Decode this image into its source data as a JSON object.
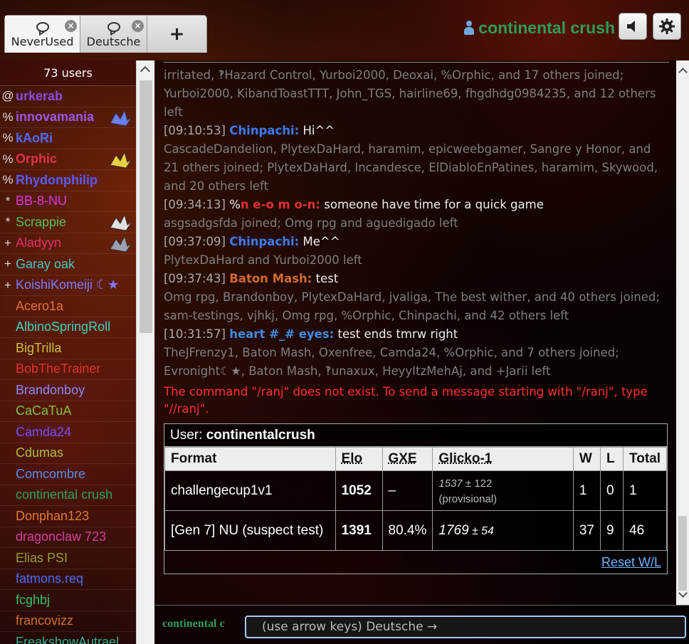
{
  "tabs": [
    {
      "label": "NeverUsed"
    },
    {
      "label": "Deutsche"
    }
  ],
  "tab_add_label": "+",
  "header": {
    "username": "continental crush"
  },
  "userlist": {
    "count_label": "73 users",
    "users": [
      {
        "rank": "@",
        "name": "urkerab",
        "color": "#8b4cd9",
        "bold": true
      },
      {
        "rank": "%",
        "name": "innovamania",
        "color": "#9a59e0",
        "bold": true,
        "sprite": "blue"
      },
      {
        "rank": "%",
        "name": "kAoRi",
        "color": "#4e6cf2",
        "bold": true
      },
      {
        "rank": "%",
        "name": "Orphic",
        "color": "#e0304a",
        "bold": true,
        "sprite": "yellow"
      },
      {
        "rank": "%",
        "name": "Rhydonphilip",
        "color": "#5a5cf5",
        "bold": true
      },
      {
        "rank": "*",
        "name": "BB-8-NU",
        "color": "#d83ad4",
        "bold": false
      },
      {
        "rank": "*",
        "name": "Scrappie",
        "color": "#4fc15f",
        "bold": false,
        "sprite": "white"
      },
      {
        "rank": "+",
        "name": "Aladyyn",
        "color": "#e0306a",
        "bold": false,
        "sprite": "grey"
      },
      {
        "rank": "+",
        "name": "Garay oak",
        "color": "#47c4c4",
        "bold": false
      },
      {
        "rank": "+",
        "name": "KoishiKomeiji ☾★",
        "color": "#7c7cf7",
        "bold": false
      },
      {
        "rank": "",
        "name": "Acero1a",
        "color": "#e0703a",
        "bold": false
      },
      {
        "rank": "",
        "name": "AlbinoSpringRoll",
        "color": "#40d0c0",
        "bold": false
      },
      {
        "rank": "",
        "name": "BigTrilla",
        "color": "#c9c040",
        "bold": false
      },
      {
        "rank": "",
        "name": "BobTheTrainer",
        "color": "#e03030",
        "bold": false
      },
      {
        "rank": "",
        "name": "Brandonboy",
        "color": "#8a8af5",
        "bold": false
      },
      {
        "rank": "",
        "name": "CaCaTuA",
        "color": "#80c040",
        "bold": false
      },
      {
        "rank": "",
        "name": "Camda24",
        "color": "#7050f0",
        "bold": false
      },
      {
        "rank": "",
        "name": "Cdumas",
        "color": "#a8c040",
        "bold": false
      },
      {
        "rank": "",
        "name": "Comcombre",
        "color": "#5a8ce0",
        "bold": false
      },
      {
        "rank": "",
        "name": "continental crush",
        "color": "#2ea060",
        "bold": false
      },
      {
        "rank": "",
        "name": "Donphan123",
        "color": "#e07a30",
        "bold": false
      },
      {
        "rank": "",
        "name": "dragonclaw 723",
        "color": "#d040a0",
        "bold": false
      },
      {
        "rank": "",
        "name": "Elias PSI",
        "color": "#90a030",
        "bold": false
      },
      {
        "rank": "",
        "name": "fatmons.req",
        "color": "#4c6cf0",
        "bold": false
      },
      {
        "rank": "",
        "name": "fcghbj",
        "color": "#30c070",
        "bold": false
      },
      {
        "rank": "",
        "name": "francovizz",
        "color": "#d07030",
        "bold": false
      },
      {
        "rank": "",
        "name": "FreakshowAutrael",
        "color": "#30b090",
        "bold": false
      }
    ]
  },
  "chat": {
    "messages": [
      {
        "type": "notice",
        "text": "irritated, ‽Hazard Control, Yurboi2000, Deoxai, %Orphic, and 17 others joined; Yurboi2000, KibandToastTTT, John_TGS, hairline69, fhgdhdg0984235, and 12 others left"
      },
      {
        "type": "chat",
        "time": "[09:10:53]",
        "rank": "",
        "speaker": "Chinpachi:",
        "color": "#3f7bf0",
        "text": "Hi^^"
      },
      {
        "type": "notice",
        "text": "CascadeDandelion, PlytexDaHard, haramim, epicweebgamer, Sangre y Honor, and 21 others joined; PlytexDaHard, Incandesce, ElDiabloEnPatines, haramim, Skywood, and 20 others left"
      },
      {
        "type": "chat",
        "time": "[09:34:13]",
        "rank": "%",
        "speaker": "n e-o m o-n:",
        "color": "#e03030",
        "text": "someone have time for a quick game"
      },
      {
        "type": "notice",
        "text": "asgsadgsfda joined; Omg rpg and aguedigado left"
      },
      {
        "type": "chat",
        "time": "[09:37:09]",
        "rank": "",
        "speaker": "Chinpachi:",
        "color": "#3f7bf0",
        "text": "Me^^"
      },
      {
        "type": "notice",
        "text": "PlytexDaHard and Yurboi2000 left"
      },
      {
        "type": "chat",
        "time": "[09:37:43]",
        "rank": "",
        "speaker": "Baton Mash:",
        "color": "#d06a30",
        "text": "test"
      },
      {
        "type": "notice",
        "text": "Omg rpg, Brandonboy, PlytexDaHard, jvaliga, The best wither, and 40 others joined; sam-testings, vjhkj, Omg rpg, %Orphic, Chinpachi, and 42 others left"
      },
      {
        "type": "chat",
        "time": "[10:31:57]",
        "rank": "",
        "speaker": "heart #_# eyes:",
        "color": "#3f8be0",
        "text": "test ends tmrw right"
      },
      {
        "type": "notice",
        "text": "TheJFrenzy1, Baton Mash, Oxenfree, Camda24, %Orphic, and 7 others joined; Evronight☾★, Baton Mash, ‽unaxux, HeyyItzMehAj, and +Jarii left"
      }
    ],
    "error": "The command \"/ranj\" does not exist. To send a message starting with \"/ranj\", type \"//ranj\"."
  },
  "stats": {
    "user_label": "User: ",
    "user_name": "continentalcrush",
    "headers": {
      "format": "Format",
      "elo": "Elo",
      "gxe": "GXE",
      "glicko": "Glicko-1",
      "w": "W",
      "l": "L",
      "total": "Total"
    },
    "rows": [
      {
        "format": "challengecup1v1",
        "elo": "1052",
        "gxe": "–",
        "glicko": "1537",
        "glicko_dev": " ± 122",
        "provisional": "(provisional)",
        "w": "1",
        "l": "0",
        "total": "1"
      },
      {
        "format": "[Gen 7] NU (suspect test)",
        "elo": "1391",
        "gxe": "80.4%",
        "glicko": "1769",
        "glicko_dev": " ± 54",
        "provisional": "",
        "w": "37",
        "l": "9",
        "total": "46"
      }
    ],
    "reset_label": "Reset W/L"
  },
  "input": {
    "prompt": "continental c",
    "placeholder": "(use arrow keys) Deutsche →"
  }
}
